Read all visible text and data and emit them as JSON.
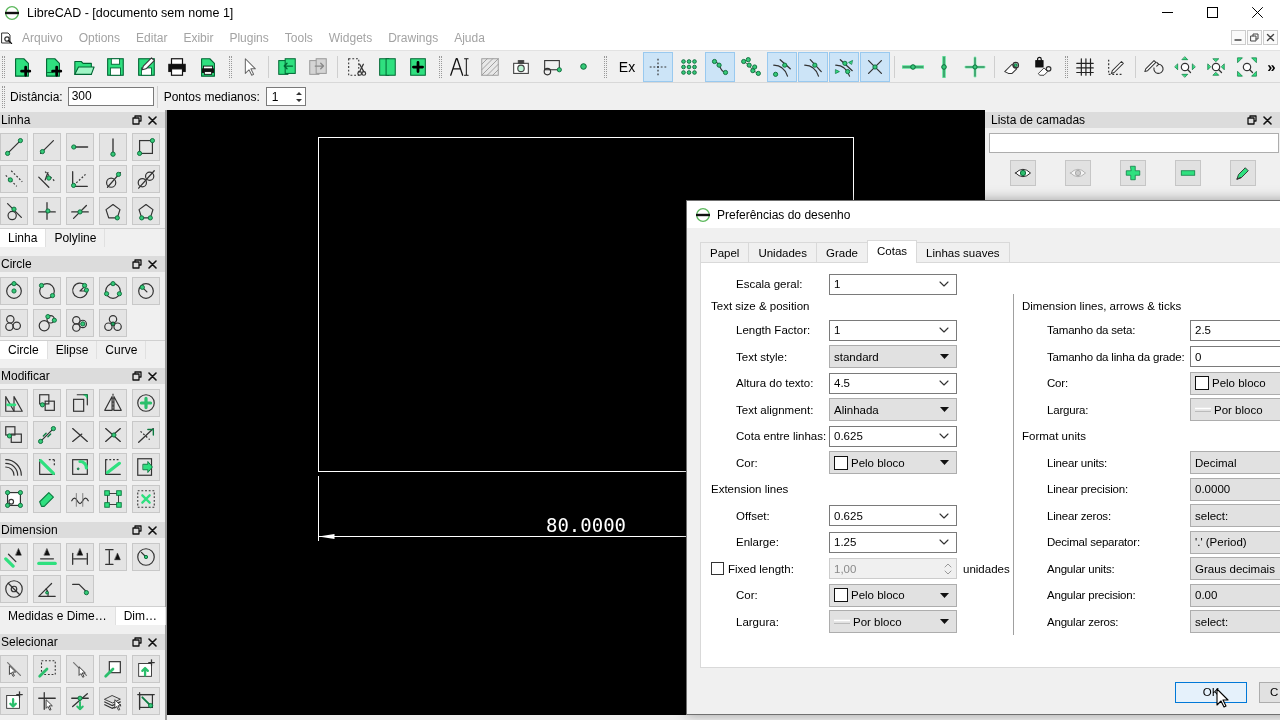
{
  "window": {
    "title": "LibreCAD - [documento sem nome 1]"
  },
  "menu": [
    {
      "label": "Arquivo",
      "disabled": true
    },
    {
      "label": "Options",
      "disabled": true
    },
    {
      "label": "Editar",
      "disabled": true
    },
    {
      "label": "Exibir",
      "disabled": true
    },
    {
      "label": "Plugins",
      "disabled": true
    },
    {
      "label": "Tools",
      "disabled": true
    },
    {
      "label": "Widgets",
      "disabled": true
    },
    {
      "label": "Drawings",
      "disabled": true
    },
    {
      "label": "Ajuda",
      "disabled": true
    }
  ],
  "toolbar": {
    "text_button": "Ex",
    "snap_buttons": [
      {
        "selected": true
      },
      {
        "selected": false
      },
      {
        "selected": true
      },
      {
        "selected": false
      },
      {
        "selected": true
      },
      {
        "selected": true
      },
      {
        "selected": true
      },
      {
        "selected": true
      }
    ],
    "overflow": "»"
  },
  "options_bar": {
    "fields": [
      {
        "kind": "text",
        "label": "Distância:",
        "value": "300"
      },
      {
        "kind": "spin",
        "label": "Pontos medianos:",
        "value": "1"
      }
    ]
  },
  "left_dock": [
    {
      "title": "Linha",
      "tabs": [
        {
          "label": "Linha",
          "selected": true
        },
        {
          "label": "Polyline",
          "selected": false
        }
      ]
    },
    {
      "title": "Circle",
      "tabs": [
        {
          "label": "Circle",
          "selected": true
        },
        {
          "label": "Elipse",
          "selected": false
        },
        {
          "label": "Curve",
          "selected": false
        }
      ]
    },
    {
      "title": "Modificar"
    },
    {
      "title": "Dimension",
      "tabs": [
        {
          "label": "Medidas e Dime…",
          "selected": false
        },
        {
          "label": "Dim…",
          "selected": true
        }
      ]
    },
    {
      "title": "Selecionar"
    }
  ],
  "canvas": {
    "dimension_text": "80.0000"
  },
  "layer_panel": {
    "title": "Lista de camadas"
  },
  "dialog": {
    "title": "Preferências do desenho",
    "tabs": [
      {
        "label": "Papel",
        "selected": false
      },
      {
        "label": "Unidades",
        "selected": false
      },
      {
        "label": "Grade",
        "selected": false
      },
      {
        "label": "Cotas",
        "selected": true
      },
      {
        "label": "Linhas suaves",
        "selected": false
      }
    ],
    "top_rows": [
      {
        "kind": "combo",
        "label": "Escala geral:",
        "value": "1"
      }
    ],
    "columns": [
      [
        {
          "kind": "heading",
          "label": "Text size & position"
        },
        {
          "kind": "combo",
          "label": "Length Factor:",
          "value": "1"
        },
        {
          "kind": "dropdown",
          "label": "Text style:",
          "value": "standard"
        },
        {
          "kind": "combo",
          "label": "Altura do texto:",
          "value": "4.5"
        },
        {
          "kind": "dropdown",
          "label": "Text alignment:",
          "value": "Alinhada"
        },
        {
          "kind": "combo",
          "label": "Cota entre linhas:",
          "value": "0.625"
        },
        {
          "kind": "color",
          "label": "Cor:",
          "value": "Pelo bloco"
        },
        {
          "kind": "heading",
          "label": "Extension lines"
        },
        {
          "kind": "combo",
          "label": "Offset:",
          "value": "0.625"
        },
        {
          "kind": "combo",
          "label": "Enlarge:",
          "value": "1.25"
        },
        {
          "kind": "check",
          "label": "Fixed length:",
          "checked": false,
          "value": "1,00",
          "disabled": true,
          "unit": "unidades"
        },
        {
          "kind": "color",
          "label": "Cor:",
          "value": "Pelo bloco"
        },
        {
          "kind": "linewidth",
          "label": "Largura:",
          "value": "Por bloco"
        }
      ],
      [
        {
          "kind": "heading",
          "label": "Dimension lines, arrows & ticks"
        },
        {
          "kind": "field",
          "label": "Tamanho da seta:",
          "value": "2.5"
        },
        {
          "kind": "field",
          "label": "Tamanho da linha da grade:",
          "value": "0"
        },
        {
          "kind": "color",
          "label": "Cor:",
          "value": "Pelo bloco"
        },
        {
          "kind": "linewidth",
          "label": "Largura:",
          "value": "Por bloco"
        },
        {
          "kind": "heading",
          "label": "Format units"
        },
        {
          "kind": "dropdown",
          "label": "Linear units:",
          "value": "Decimal"
        },
        {
          "kind": "dropdown",
          "label": "Linear precision:",
          "value": "0.0000"
        },
        {
          "kind": "dropdown",
          "label": "Linear zeros:",
          "value": "select:"
        },
        {
          "kind": "dropdown",
          "label": "Decimal separator:",
          "value": "'.' (Period)"
        },
        {
          "kind": "dropdown",
          "label": "Angular units:",
          "value": "Graus decimais"
        },
        {
          "kind": "dropdown",
          "label": "Angular precision:",
          "value": "0.00"
        },
        {
          "kind": "dropdown",
          "label": "Angular zeros:",
          "value": "select:"
        }
      ]
    ],
    "buttons": [
      {
        "label": "OK",
        "focused": true
      },
      {
        "label": "C",
        "focused": false
      }
    ]
  }
}
